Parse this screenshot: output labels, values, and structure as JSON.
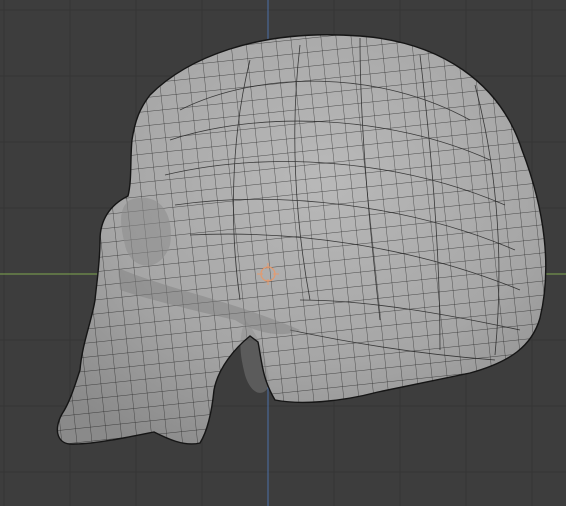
{
  "viewport": {
    "background": "#3d3d3d",
    "grid_color": "#353535",
    "x_axis_color": "#7ea650",
    "z_axis_color": "#4a6fa8",
    "view": "orthographic-side",
    "overlay": "wireframe"
  },
  "object": {
    "type": "skull",
    "shading": "solid",
    "surface_color": "#a9a9a9",
    "wire_color": "#1c1c1c",
    "selected": false
  },
  "origin": {
    "icon": "origin-gizmo-icon",
    "color": "#e59a6d"
  },
  "icons": {
    "origin": "origin-gizmo-icon"
  }
}
